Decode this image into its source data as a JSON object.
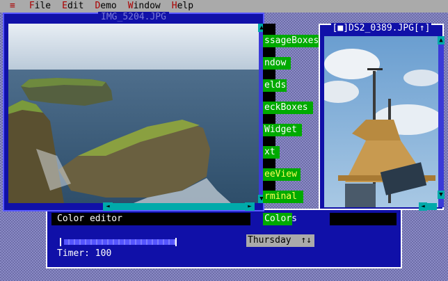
{
  "menu": {
    "system_icon": "≡",
    "items": [
      {
        "hot": "F",
        "rest": "ile"
      },
      {
        "hot": "E",
        "rest": "dit"
      },
      {
        "hot": "D",
        "rest": "emo"
      },
      {
        "hot": "W",
        "rest": "indow"
      },
      {
        "hot": "H",
        "rest": "elp"
      }
    ]
  },
  "left_window": {
    "title": "IMG_5204.JPG"
  },
  "right_window": {
    "title": "[■]DS2_0389.JPG[↑]"
  },
  "controls": [
    {
      "label": "ssageBoxes"
    },
    {
      "label": "ndow"
    },
    {
      "label": "elds"
    },
    {
      "label": "eckBoxes"
    },
    {
      "label": "Widget"
    },
    {
      "label": "xt"
    },
    {
      "label": "eeView"
    },
    {
      "label": "rminal"
    },
    {
      "label": "Colors"
    }
  ],
  "color_editor": {
    "title": "Color editor",
    "timer_text": "Timer: 100",
    "slider_fraction": 1.0
  },
  "day_select": {
    "value": "Thursday",
    "arrows": "↑↓"
  },
  "colors": {
    "window_bg": "#1010a8",
    "button": "#00aa00",
    "scroll": "#00aaaa",
    "menubar": "#aaaaaa"
  }
}
